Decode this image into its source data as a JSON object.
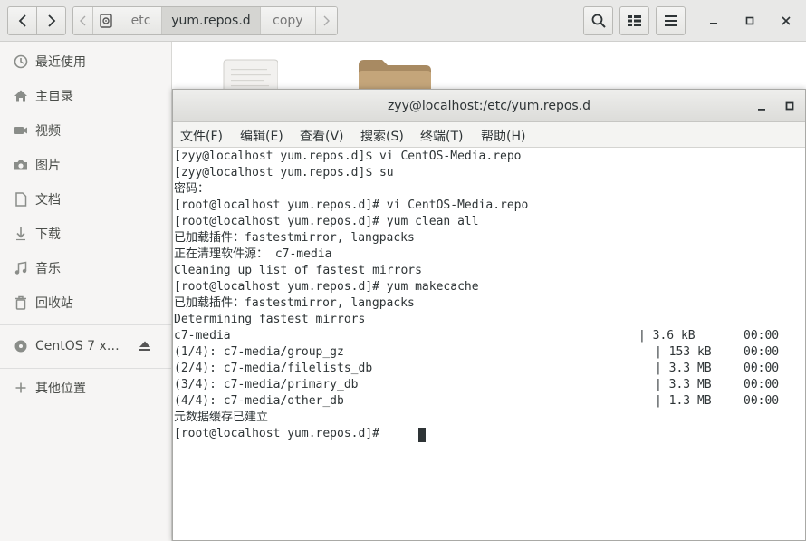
{
  "file_manager": {
    "path": {
      "segments": [
        "etc",
        "yum.repos.d",
        "copy"
      ],
      "current": "yum.repos.d"
    },
    "sidebar": {
      "items": [
        {
          "label": "最近使用",
          "icon": "clock-icon"
        },
        {
          "label": "主目录",
          "icon": "home-icon"
        },
        {
          "label": "视频",
          "icon": "video-icon"
        },
        {
          "label": "图片",
          "icon": "camera-icon"
        },
        {
          "label": "文档",
          "icon": "document-icon"
        },
        {
          "label": "下载",
          "icon": "download-icon"
        },
        {
          "label": "音乐",
          "icon": "music-icon"
        },
        {
          "label": "回收站",
          "icon": "trash-icon"
        }
      ],
      "devices": [
        {
          "label": "CentOS 7 x…",
          "icon": "disc-icon"
        }
      ],
      "other_locations": {
        "label": "其他位置",
        "icon": "plus-icon"
      }
    }
  },
  "terminal": {
    "title": "zyy@localhost:/etc/yum.repos.d",
    "menu": [
      "文件(F)",
      "编辑(E)",
      "查看(V)",
      "搜索(S)",
      "终端(T)",
      "帮助(H)"
    ],
    "lines": [
      "[zyy@localhost yum.repos.d]$ vi CentOS-Media.repo",
      "[zyy@localhost yum.repos.d]$ su",
      "密码：",
      "[root@localhost yum.repos.d]# vi CentOS-Media.repo",
      "[root@localhost yum.repos.d]# yum clean all",
      "已加载插件：fastestmirror, langpacks",
      "正在清理软件源： c7-media",
      "Cleaning up list of fastest mirrors",
      "[root@localhost yum.repos.d]# yum makecache",
      "已加载插件：fastestmirror, langpacks",
      "Determining fastest mirrors",
      "c7-media",
      "(1/4): c7-media/group_gz",
      "(2/4): c7-media/filelists_db",
      "(3/4): c7-media/primary_db",
      "(4/4): c7-media/other_db",
      "元数据缓存已建立",
      "[root@localhost yum.repos.d]# "
    ],
    "progress_rows": [
      {
        "size": "| 3.6 kB",
        "time": "00:00"
      },
      {
        "size": "| 153 kB",
        "time": "00:00"
      },
      {
        "size": "| 3.3 MB",
        "time": "00:00"
      },
      {
        "size": "| 3.3 MB",
        "time": "00:00"
      },
      {
        "size": "| 1.3 MB",
        "time": "00:00"
      }
    ]
  }
}
